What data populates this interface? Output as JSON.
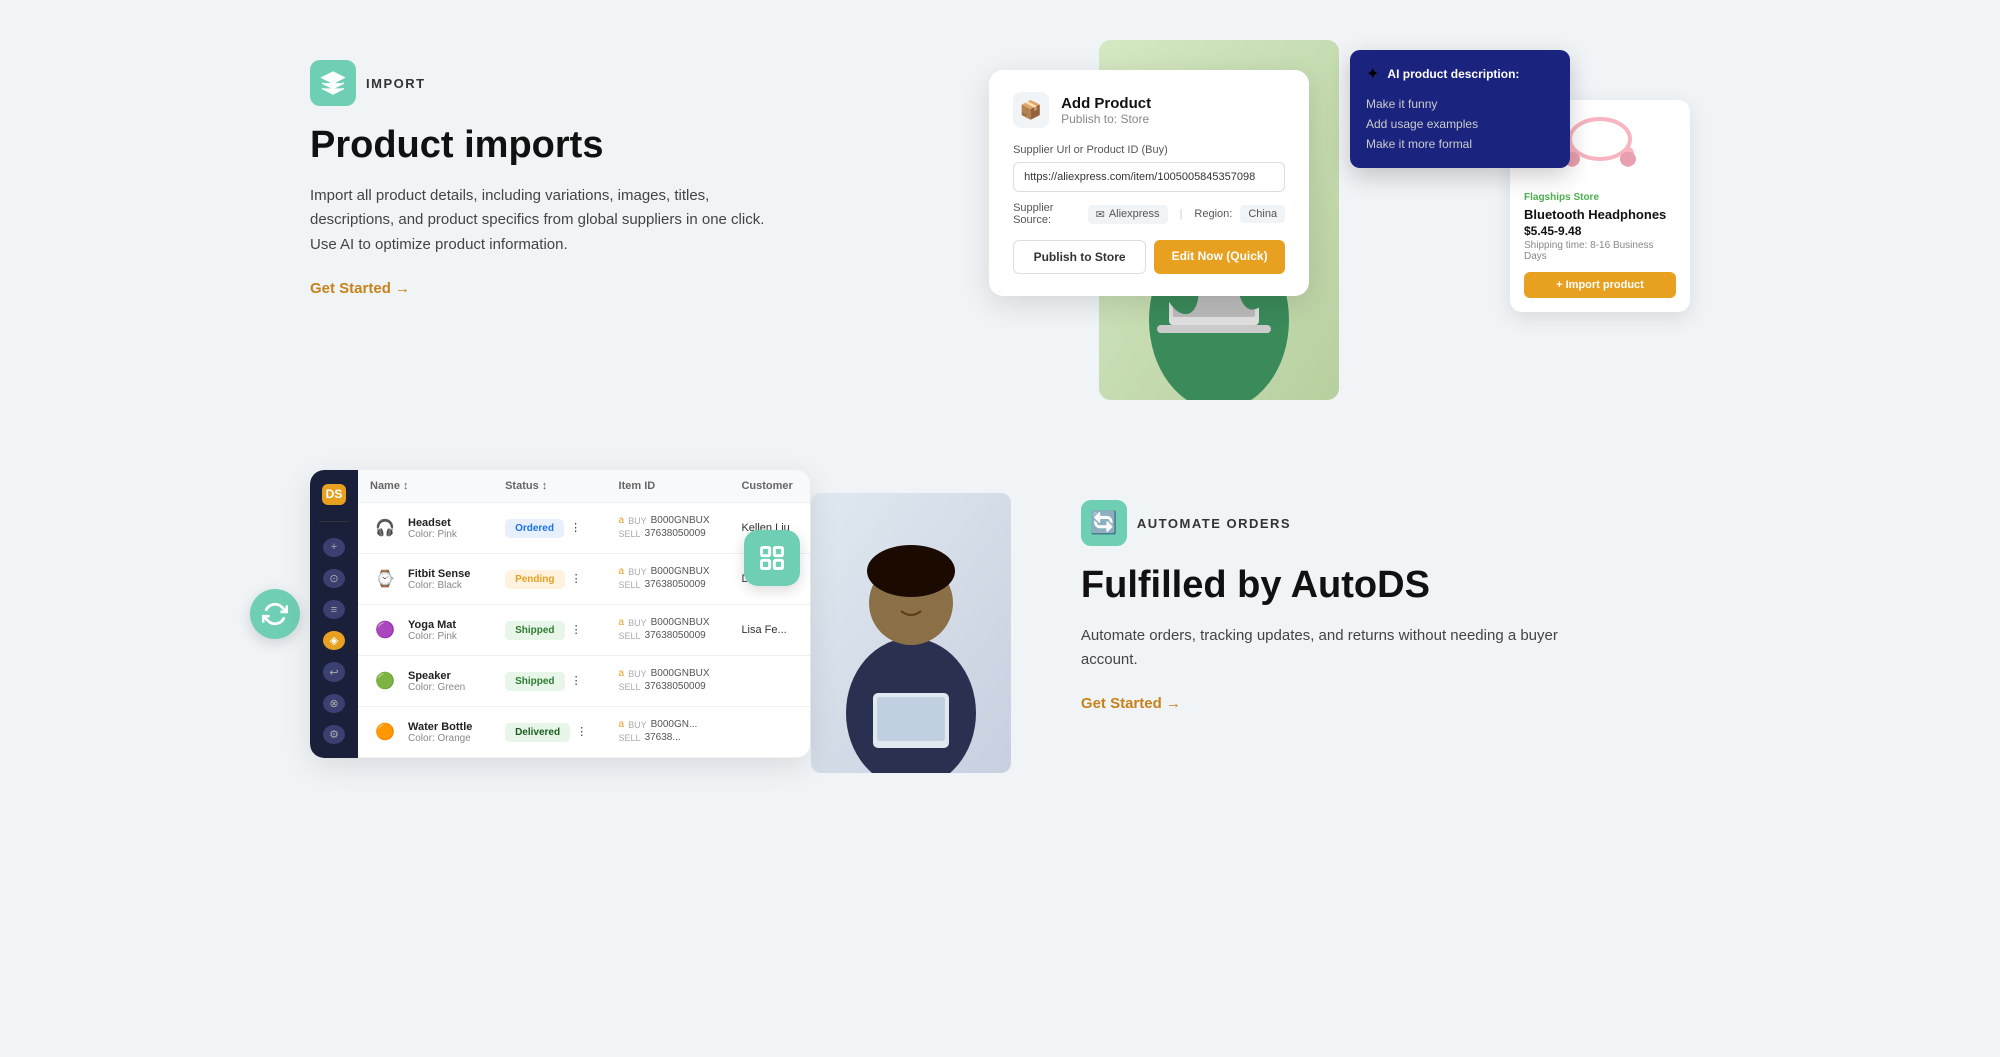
{
  "page": {
    "background": "#f0f4f7"
  },
  "top_left": {
    "badge_label": "IMPORT",
    "title": "Product imports",
    "description": "Import all product details, including variations, images, titles, descriptions, and product specifics from global suppliers in one click. Use AI to optimize product information.",
    "get_started": "Get Started →"
  },
  "product_ui": {
    "title": "Add Product",
    "subtitle": "Publish to: Store",
    "input_label": "Supplier Url or Product ID (Buy)",
    "input_value": "https://aliexpress.com/item/1005005845357098",
    "supplier_label": "Supplier Source:",
    "supplier_name": "Aliexpress",
    "region_label": "Region:",
    "region_value": "China",
    "btn_publish": "Publish to Store",
    "btn_edit": "Edit Now (Quick)"
  },
  "ai_dropdown": {
    "title": "AI product description:",
    "options": [
      "Make it funny",
      "Add usage examples",
      "Make it more formal"
    ]
  },
  "product_card": {
    "store": "Flagships Store",
    "name": "Bluetooth Headphones",
    "price": "$5.45-9.48",
    "shipping": "Shipping time: 8-16 Business Days",
    "btn_import": "+ Import product"
  },
  "bottom_left": {
    "table": {
      "columns": [
        "Name",
        "Status",
        "Item ID",
        "Customer"
      ],
      "rows": [
        {
          "name": "Headset",
          "variant": "Color: Pink",
          "status": "Ordered",
          "status_type": "ordered",
          "buy_id": "B000GNBUX",
          "sell_id": "37638050009",
          "customer": "Kellen Liu",
          "emoji": "🎧"
        },
        {
          "name": "Fitbit Sense",
          "variant": "Color: Black",
          "status": "Pending",
          "status_type": "pending",
          "buy_id": "B000GNBUX",
          "sell_id": "37638050009",
          "customer": "De...",
          "emoji": "⌚"
        },
        {
          "name": "Yoga Mat",
          "variant": "Color: Pink",
          "status": "Shipped",
          "status_type": "shipped",
          "buy_id": "B000GNBUX",
          "sell_id": "37638050009",
          "customer": "Lisa Fe...",
          "emoji": "🟣"
        },
        {
          "name": "Speaker",
          "variant": "Color: Green",
          "status": "Shipped",
          "status_type": "shipped",
          "buy_id": "B000GNBUX",
          "sell_id": "37638050009",
          "customer": "",
          "emoji": "🟢"
        },
        {
          "name": "Water Bottle",
          "variant": "Color: Orange",
          "status": "Delivered",
          "status_type": "delivered",
          "buy_id": "B000GN...",
          "sell_id": "37638...",
          "customer": "",
          "emoji": "🟠"
        }
      ]
    }
  },
  "bottom_right": {
    "badge_label": "AUTOMATE ORDERS",
    "title": "Fulfilled by AutoDS",
    "description": "Automate orders, tracking updates, and returns without needing a buyer account.",
    "get_started": "Get Started →"
  }
}
